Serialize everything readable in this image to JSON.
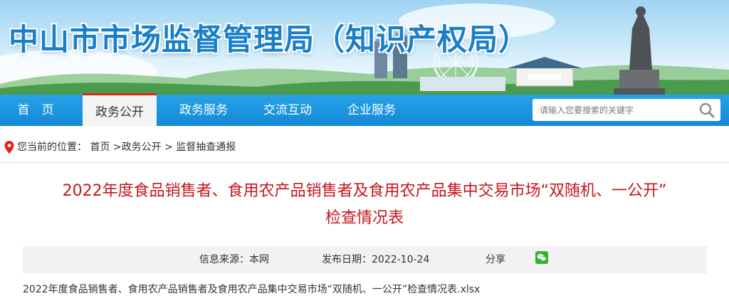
{
  "site": {
    "title": "中山市市场监督管理局（知识产权局）"
  },
  "nav": {
    "items": [
      {
        "label": "首　页"
      },
      {
        "label": "政务公开"
      },
      {
        "label": "政务服务"
      },
      {
        "label": "交流互动"
      },
      {
        "label": "企业服务"
      }
    ],
    "active": "政务公开"
  },
  "search": {
    "placeholder": "请输入您要搜索的关键字",
    "icon": "search-icon"
  },
  "breadcrumb": {
    "prefix": "您当前的位置：",
    "items": [
      "首页",
      ">政务公开",
      ">",
      "监督抽查通报"
    ]
  },
  "article": {
    "title_line1": "2022年度食品销售者、食用农产品销售者及食用农产品集中交易市场“双随机、一公开”",
    "title_line2": "检查情况表",
    "source": "信息来源：本网",
    "publish_date": "发布日期：2022-10-24",
    "share_label": "分享",
    "attachment": "2022年度食品销售者、食用农产品销售者及食用农产品集中交易市场“双随机、一公开”检查情况表.xlsx"
  },
  "colors": {
    "nav_blue": "#1b93dd",
    "title_red": "#c4161c",
    "accent_red": "#e2231a",
    "banner_title": "#1a7fc9"
  }
}
